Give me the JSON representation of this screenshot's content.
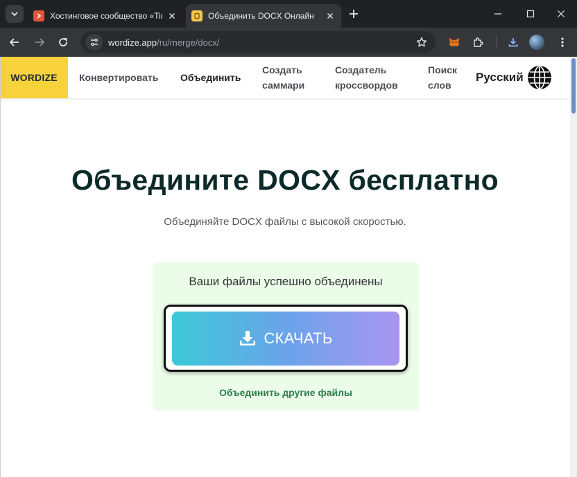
{
  "browser": {
    "tabs": [
      {
        "title": "Хостинговое сообщество «Tim",
        "favicon": "timeweb-favicon",
        "active": false
      },
      {
        "title": "Объединить DOCX Онлайн",
        "favicon": "wordize-favicon",
        "active": true
      }
    ],
    "url": {
      "host": "wordize.app",
      "path": "/ru/merge/docx/"
    }
  },
  "site": {
    "brand": "WORDIZE",
    "nav": [
      {
        "label": "Конвертировать"
      },
      {
        "label": "Объединить"
      },
      {
        "label": "Создать саммари"
      },
      {
        "label": "Создатель кроссвордов"
      },
      {
        "label": "Поиск слов"
      }
    ],
    "language": "Русский"
  },
  "hero": {
    "title": "Объедините DOCX бесплатно",
    "subtitle": "Объединяйте DOCX файлы с высокой скоростью."
  },
  "result": {
    "message": "Ваши файлы успешно объединены",
    "download_label": "СКАЧАТЬ",
    "merge_other_label": "Объединить другие файлы"
  },
  "colors": {
    "brand_yellow": "#f7d23b",
    "result_bg": "#ebfde9",
    "gradient_start": "#3cc8d8",
    "gradient_end": "#a995f1",
    "link_green": "#2e7d4f"
  }
}
